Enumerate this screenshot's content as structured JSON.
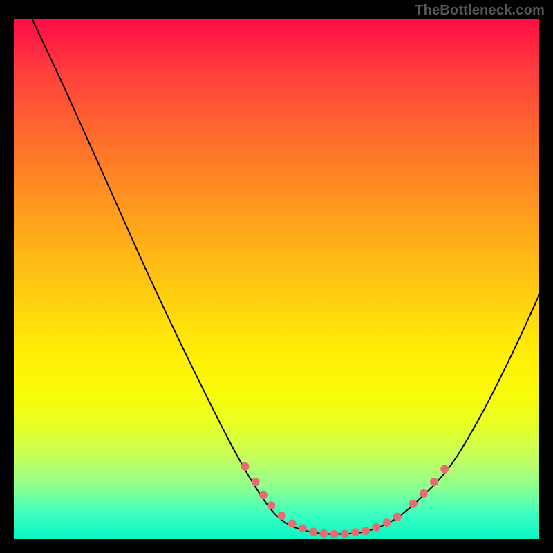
{
  "watermark": "TheBottleneck.com",
  "chart_data": {
    "type": "line",
    "title": "",
    "xlabel": "",
    "ylabel": "",
    "xlim": [
      0,
      100
    ],
    "ylim": [
      0,
      100
    ],
    "grid": false,
    "legend": false,
    "curve": [
      {
        "x": 3.5,
        "y": 100
      },
      {
        "x": 10,
        "y": 86
      },
      {
        "x": 18,
        "y": 68
      },
      {
        "x": 26,
        "y": 50
      },
      {
        "x": 34,
        "y": 33
      },
      {
        "x": 42,
        "y": 17
      },
      {
        "x": 48,
        "y": 7
      },
      {
        "x": 52,
        "y": 3
      },
      {
        "x": 57,
        "y": 1.3
      },
      {
        "x": 62,
        "y": 1.0
      },
      {
        "x": 67,
        "y": 1.5
      },
      {
        "x": 72,
        "y": 3.5
      },
      {
        "x": 77,
        "y": 7.5
      },
      {
        "x": 83,
        "y": 14
      },
      {
        "x": 89,
        "y": 24
      },
      {
        "x": 95,
        "y": 36
      },
      {
        "x": 100,
        "y": 47
      }
    ],
    "dots": [
      {
        "x": 44,
        "y": 14
      },
      {
        "x": 46,
        "y": 11
      },
      {
        "x": 47.5,
        "y": 8.5
      },
      {
        "x": 49,
        "y": 6.5
      },
      {
        "x": 51,
        "y": 4.5
      },
      {
        "x": 53,
        "y": 3
      },
      {
        "x": 55,
        "y": 2.1
      },
      {
        "x": 57,
        "y": 1.4
      },
      {
        "x": 59,
        "y": 1.1
      },
      {
        "x": 61,
        "y": 0.95
      },
      {
        "x": 63,
        "y": 1.0
      },
      {
        "x": 65,
        "y": 1.3
      },
      {
        "x": 67,
        "y": 1.6
      },
      {
        "x": 69,
        "y": 2.3
      },
      {
        "x": 71,
        "y": 3.2
      },
      {
        "x": 73,
        "y": 4.3
      },
      {
        "x": 76,
        "y": 6.8
      },
      {
        "x": 78,
        "y": 8.8
      },
      {
        "x": 80,
        "y": 11
      },
      {
        "x": 82,
        "y": 13.5
      }
    ],
    "background_gradient": {
      "top": "#ff0b46",
      "mid": "#fff205",
      "bottom": "#08f6c7"
    },
    "dot_color": "#e86b6f",
    "line_color": "#000000"
  }
}
